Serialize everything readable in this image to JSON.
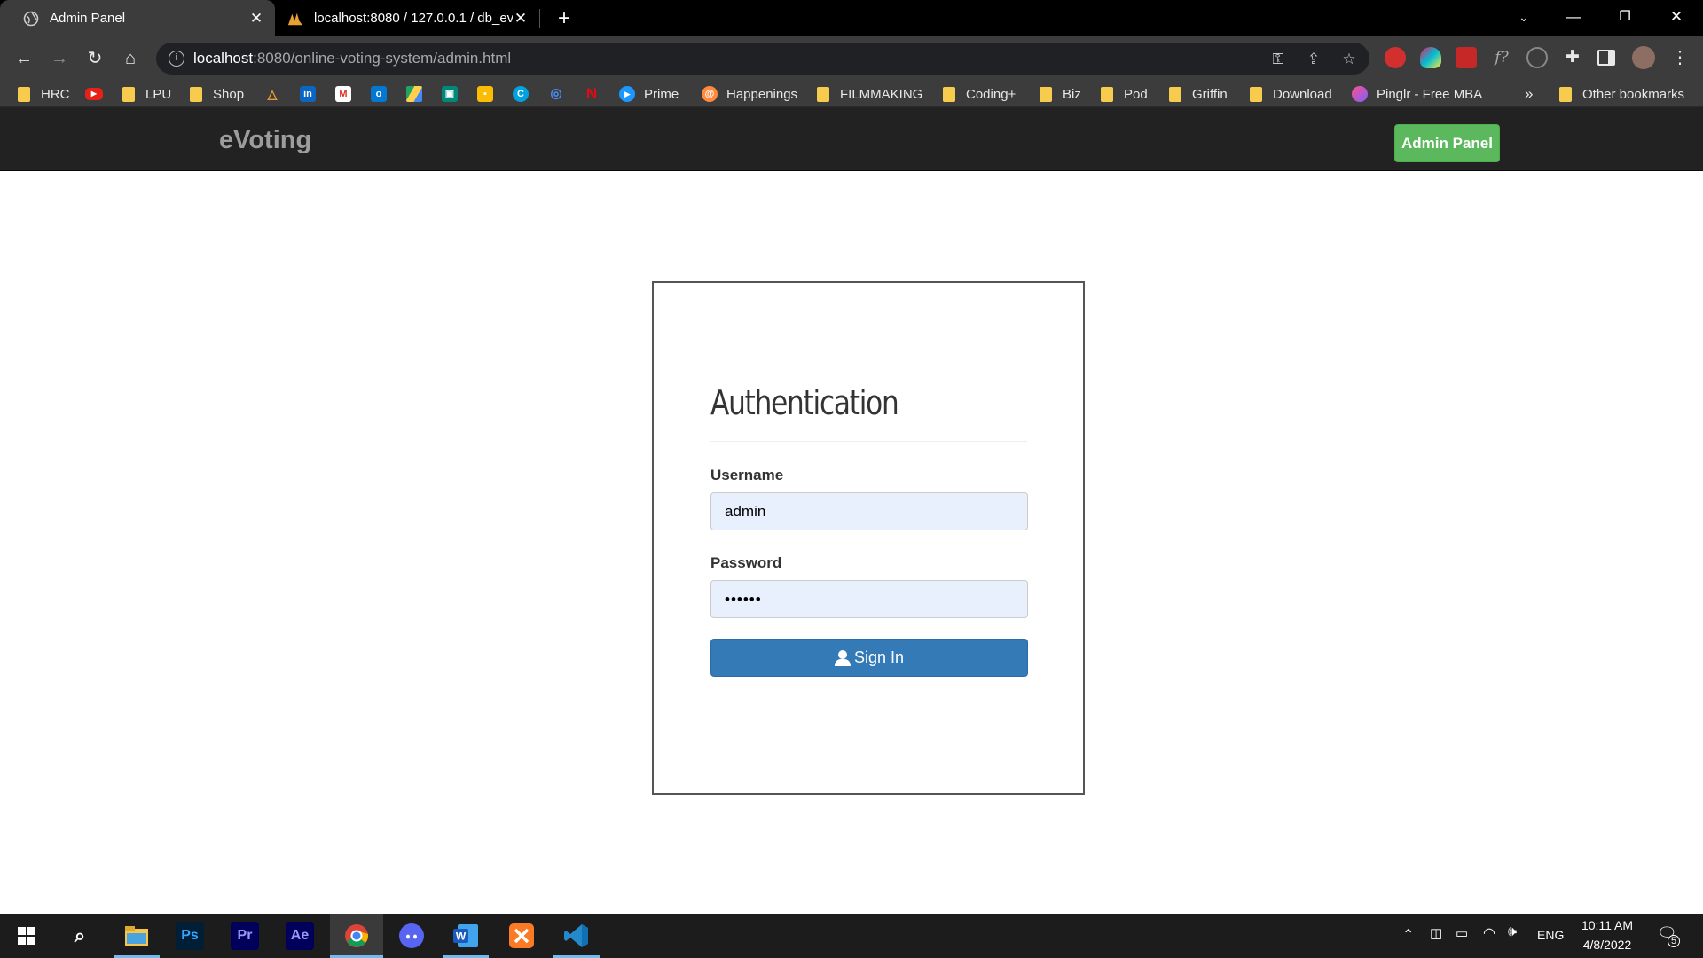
{
  "browser": {
    "tabs": [
      {
        "title": "Admin Panel",
        "active": true
      },
      {
        "title": "localhost:8080 / 127.0.0.1 / db_ev",
        "active": false
      }
    ],
    "url_host": "localhost",
    "url_rest": ":8080/online-voting-system/admin.html",
    "bookmarks": [
      "HRC",
      "LPU",
      "Shop",
      "Prime",
      "Happenings",
      "FILMMAKING",
      "Coding+",
      "Biz",
      "Pod",
      "Griffin",
      "Download",
      "Pinglr - Free MBA",
      "Other bookmarks"
    ],
    "overflow_label": "»"
  },
  "navbar": {
    "brand": "eVoting",
    "admin_button": "Admin Panel"
  },
  "login": {
    "title": "Authentication",
    "username_label": "Username",
    "username_value": "admin",
    "password_label": "Password",
    "password_value": "••••••",
    "signin_label": "Sign In"
  },
  "taskbar": {
    "language": "ENG",
    "time": "10:11 AM",
    "date": "4/8/2022",
    "notification_count": "5",
    "apps": [
      "Ps",
      "Pr",
      "Ae"
    ]
  },
  "colors": {
    "navbar_bg": "#222222",
    "admin_button": "#5cb85c",
    "signin_button": "#337ab7",
    "input_bg": "#e8f0fe"
  }
}
